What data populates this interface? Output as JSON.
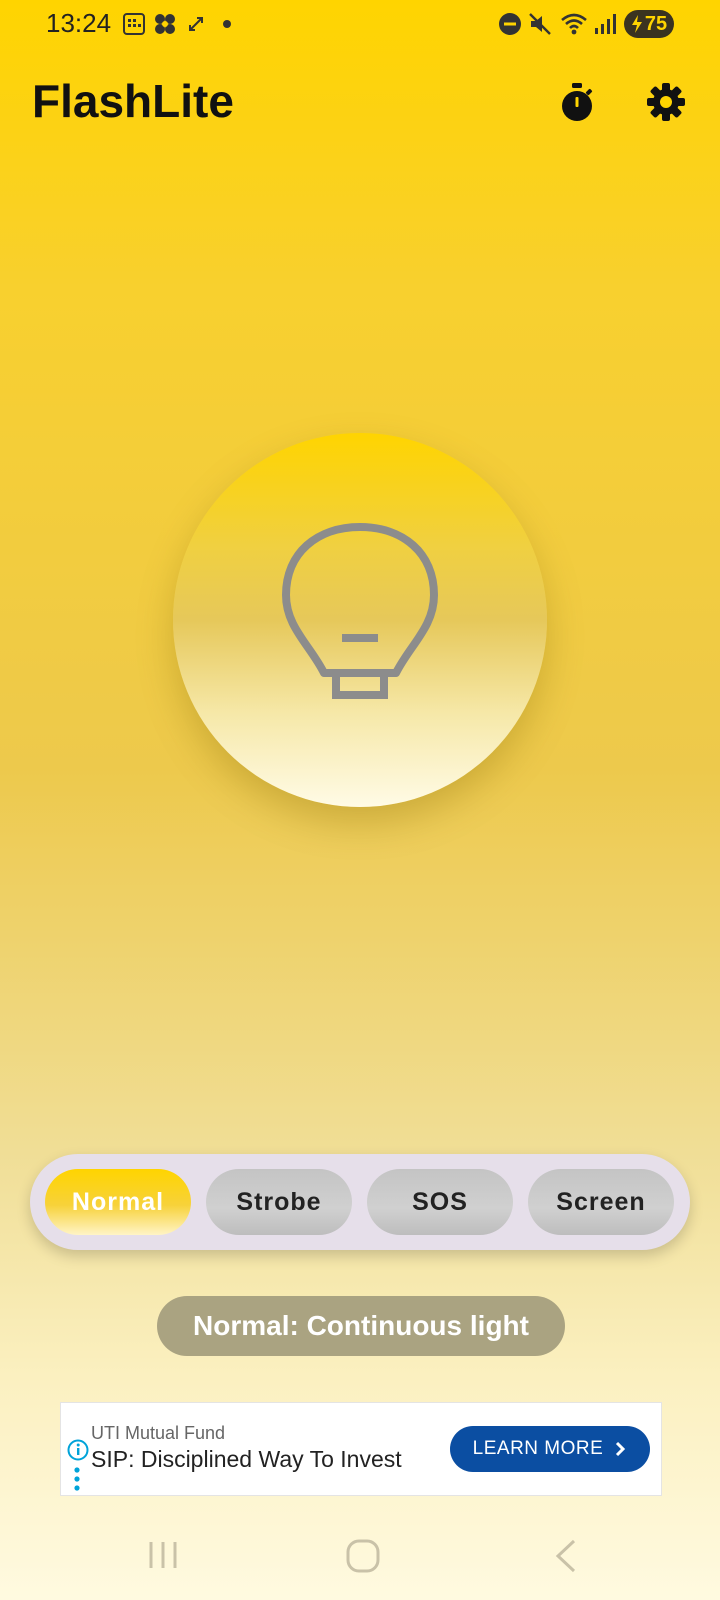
{
  "status_bar": {
    "time": "13:24",
    "battery_level": "75",
    "icons": [
      "calendar-icon",
      "pinwheel-icon",
      "expand-icon",
      "dot-icon",
      "do-not-disturb-icon",
      "mute-icon",
      "wifi-icon",
      "signal-icon",
      "battery-charging-icon"
    ]
  },
  "header": {
    "title": "FlashLite",
    "actions": [
      "timer-icon",
      "settings-gear-icon"
    ]
  },
  "power_button": {
    "icon": "lightbulb-icon",
    "state": "off"
  },
  "modes": {
    "selected": "Normal",
    "items": [
      {
        "label": "Normal"
      },
      {
        "label": "Strobe"
      },
      {
        "label": "SOS"
      },
      {
        "label": "Screen"
      }
    ]
  },
  "mode_description": "Normal: Continuous light",
  "ad": {
    "advertiser": "UTI Mutual Fund",
    "headline": "SIP: Disciplined Way To Invest",
    "cta_label": "LEARN MORE"
  },
  "colors": {
    "accent_yellow": "#FFD400",
    "ad_button_blue": "#0B4EA2",
    "description_pill": "#AAA381"
  }
}
